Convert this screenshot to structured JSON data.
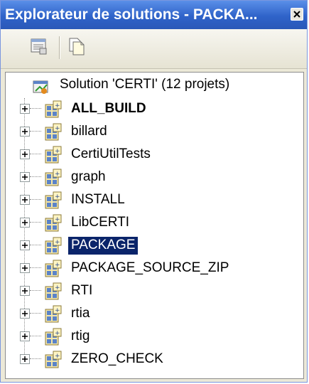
{
  "window": {
    "title": "Explorateur de solutions - PACKA...",
    "close_icon": "close-icon"
  },
  "toolbar": {
    "buttons": [
      {
        "icon": "properties-icon"
      },
      {
        "icon": "show-all-files-icon"
      }
    ]
  },
  "tree": {
    "solution_label": "Solution 'CERTI' (12 projets)",
    "projects": [
      {
        "label": "ALL_BUILD",
        "bold": true,
        "selected": false
      },
      {
        "label": "billard",
        "bold": false,
        "selected": false
      },
      {
        "label": "CertiUtilTests",
        "bold": false,
        "selected": false
      },
      {
        "label": "graph",
        "bold": false,
        "selected": false
      },
      {
        "label": "INSTALL",
        "bold": false,
        "selected": false
      },
      {
        "label": "LibCERTI",
        "bold": false,
        "selected": false
      },
      {
        "label": "PACKAGE",
        "bold": false,
        "selected": true
      },
      {
        "label": "PACKAGE_SOURCE_ZIP",
        "bold": false,
        "selected": false
      },
      {
        "label": "RTI",
        "bold": false,
        "selected": false
      },
      {
        "label": "rtia",
        "bold": false,
        "selected": false
      },
      {
        "label": "rtig",
        "bold": false,
        "selected": false
      },
      {
        "label": "ZERO_CHECK",
        "bold": false,
        "selected": false
      }
    ]
  },
  "colors": {
    "title_bar": "#2f63c9",
    "selection": "#0a246a"
  }
}
